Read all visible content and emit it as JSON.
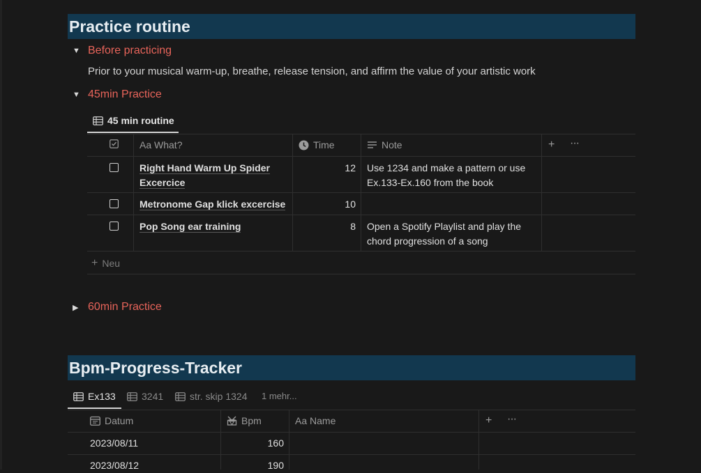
{
  "practice": {
    "heading": "Practice routine",
    "before": {
      "label": "Before practicing",
      "text": "Prior to your musical warm-up, breathe, release tension, and affirm the value of your artistic work"
    },
    "practice45": {
      "label": "45min Practice",
      "view_tab": "45 min routine",
      "columns": {
        "what": "Aa What?",
        "time": "Time",
        "note": "Note"
      },
      "rows": [
        {
          "what_line1": "Right Hand Warm Up Spider",
          "what_line2": "Excercice",
          "time": "12",
          "note_line1": "Use 1234 and make a pattern or use",
          "note_line2": "Ex.133-Ex.160 from the book"
        },
        {
          "what_line1": "Metronome Gap klick excercise",
          "time": "10"
        },
        {
          "what_line1": "Pop Song ear training",
          "time": "8",
          "note_line1": "Open a Spotify Playlist and play the",
          "note_line2": "chord progression of a song"
        }
      ],
      "new_label": "Neu"
    },
    "practice60": {
      "label": "60min Practice"
    }
  },
  "tracker": {
    "heading": "Bpm-Progress-Tracker",
    "tabs": [
      "Ex133",
      "3241",
      "str. skip 1324",
      "1 mehr..."
    ],
    "columns": {
      "date": "Datum",
      "bpm": "Bpm",
      "name": "Aa Name"
    },
    "rows": [
      {
        "date": "2023/08/11",
        "bpm": "160"
      },
      {
        "date": "2023/08/12",
        "bpm": "190"
      }
    ]
  },
  "colors": {
    "heading_bg": "#12384f",
    "toggle_label": "#e8645a",
    "page_bg": "#191919"
  }
}
